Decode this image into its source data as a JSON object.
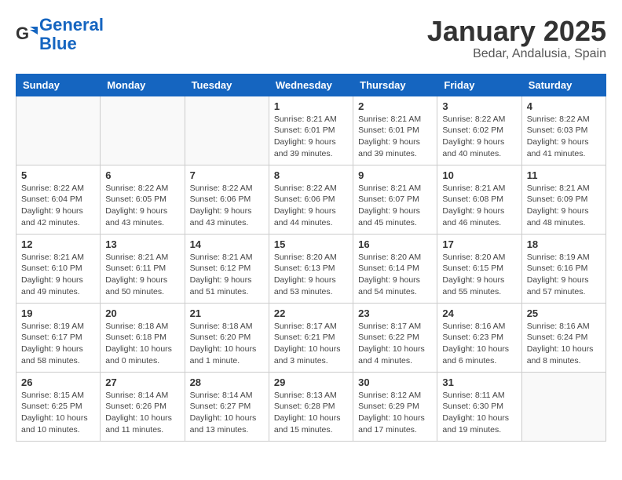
{
  "logo": {
    "line1": "General",
    "line2": "Blue"
  },
  "header": {
    "title": "January 2025",
    "subtitle": "Bedar, Andalusia, Spain"
  },
  "weekdays": [
    "Sunday",
    "Monday",
    "Tuesday",
    "Wednesday",
    "Thursday",
    "Friday",
    "Saturday"
  ],
  "weeks": [
    [
      {
        "day": "",
        "info": ""
      },
      {
        "day": "",
        "info": ""
      },
      {
        "day": "",
        "info": ""
      },
      {
        "day": "1",
        "info": "Sunrise: 8:21 AM\nSunset: 6:01 PM\nDaylight: 9 hours\nand 39 minutes."
      },
      {
        "day": "2",
        "info": "Sunrise: 8:21 AM\nSunset: 6:01 PM\nDaylight: 9 hours\nand 39 minutes."
      },
      {
        "day": "3",
        "info": "Sunrise: 8:22 AM\nSunset: 6:02 PM\nDaylight: 9 hours\nand 40 minutes."
      },
      {
        "day": "4",
        "info": "Sunrise: 8:22 AM\nSunset: 6:03 PM\nDaylight: 9 hours\nand 41 minutes."
      }
    ],
    [
      {
        "day": "5",
        "info": "Sunrise: 8:22 AM\nSunset: 6:04 PM\nDaylight: 9 hours\nand 42 minutes."
      },
      {
        "day": "6",
        "info": "Sunrise: 8:22 AM\nSunset: 6:05 PM\nDaylight: 9 hours\nand 43 minutes."
      },
      {
        "day": "7",
        "info": "Sunrise: 8:22 AM\nSunset: 6:06 PM\nDaylight: 9 hours\nand 43 minutes."
      },
      {
        "day": "8",
        "info": "Sunrise: 8:22 AM\nSunset: 6:06 PM\nDaylight: 9 hours\nand 44 minutes."
      },
      {
        "day": "9",
        "info": "Sunrise: 8:21 AM\nSunset: 6:07 PM\nDaylight: 9 hours\nand 45 minutes."
      },
      {
        "day": "10",
        "info": "Sunrise: 8:21 AM\nSunset: 6:08 PM\nDaylight: 9 hours\nand 46 minutes."
      },
      {
        "day": "11",
        "info": "Sunrise: 8:21 AM\nSunset: 6:09 PM\nDaylight: 9 hours\nand 48 minutes."
      }
    ],
    [
      {
        "day": "12",
        "info": "Sunrise: 8:21 AM\nSunset: 6:10 PM\nDaylight: 9 hours\nand 49 minutes."
      },
      {
        "day": "13",
        "info": "Sunrise: 8:21 AM\nSunset: 6:11 PM\nDaylight: 9 hours\nand 50 minutes."
      },
      {
        "day": "14",
        "info": "Sunrise: 8:21 AM\nSunset: 6:12 PM\nDaylight: 9 hours\nand 51 minutes."
      },
      {
        "day": "15",
        "info": "Sunrise: 8:20 AM\nSunset: 6:13 PM\nDaylight: 9 hours\nand 53 minutes."
      },
      {
        "day": "16",
        "info": "Sunrise: 8:20 AM\nSunset: 6:14 PM\nDaylight: 9 hours\nand 54 minutes."
      },
      {
        "day": "17",
        "info": "Sunrise: 8:20 AM\nSunset: 6:15 PM\nDaylight: 9 hours\nand 55 minutes."
      },
      {
        "day": "18",
        "info": "Sunrise: 8:19 AM\nSunset: 6:16 PM\nDaylight: 9 hours\nand 57 minutes."
      }
    ],
    [
      {
        "day": "19",
        "info": "Sunrise: 8:19 AM\nSunset: 6:17 PM\nDaylight: 9 hours\nand 58 minutes."
      },
      {
        "day": "20",
        "info": "Sunrise: 8:18 AM\nSunset: 6:18 PM\nDaylight: 10 hours\nand 0 minutes."
      },
      {
        "day": "21",
        "info": "Sunrise: 8:18 AM\nSunset: 6:20 PM\nDaylight: 10 hours\nand 1 minute."
      },
      {
        "day": "22",
        "info": "Sunrise: 8:17 AM\nSunset: 6:21 PM\nDaylight: 10 hours\nand 3 minutes."
      },
      {
        "day": "23",
        "info": "Sunrise: 8:17 AM\nSunset: 6:22 PM\nDaylight: 10 hours\nand 4 minutes."
      },
      {
        "day": "24",
        "info": "Sunrise: 8:16 AM\nSunset: 6:23 PM\nDaylight: 10 hours\nand 6 minutes."
      },
      {
        "day": "25",
        "info": "Sunrise: 8:16 AM\nSunset: 6:24 PM\nDaylight: 10 hours\nand 8 minutes."
      }
    ],
    [
      {
        "day": "26",
        "info": "Sunrise: 8:15 AM\nSunset: 6:25 PM\nDaylight: 10 hours\nand 10 minutes."
      },
      {
        "day": "27",
        "info": "Sunrise: 8:14 AM\nSunset: 6:26 PM\nDaylight: 10 hours\nand 11 minutes."
      },
      {
        "day": "28",
        "info": "Sunrise: 8:14 AM\nSunset: 6:27 PM\nDaylight: 10 hours\nand 13 minutes."
      },
      {
        "day": "29",
        "info": "Sunrise: 8:13 AM\nSunset: 6:28 PM\nDaylight: 10 hours\nand 15 minutes."
      },
      {
        "day": "30",
        "info": "Sunrise: 8:12 AM\nSunset: 6:29 PM\nDaylight: 10 hours\nand 17 minutes."
      },
      {
        "day": "31",
        "info": "Sunrise: 8:11 AM\nSunset: 6:30 PM\nDaylight: 10 hours\nand 19 minutes."
      },
      {
        "day": "",
        "info": ""
      }
    ]
  ]
}
